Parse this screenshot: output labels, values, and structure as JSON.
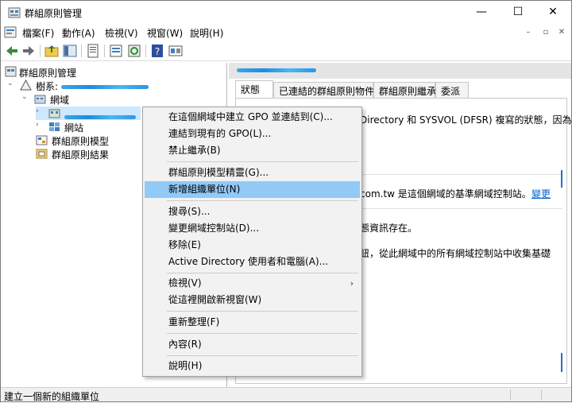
{
  "window": {
    "title": "群組原則管理",
    "controls": {
      "minimize": "—",
      "maximize": "☐",
      "close": "✕"
    }
  },
  "menubar": {
    "items": [
      "檔案(F)",
      "動作(A)",
      "檢視(V)",
      "視窗(W)",
      "說明(H)"
    ],
    "mdi": {
      "minimize": "–",
      "restore": "▫",
      "close": "✕"
    }
  },
  "toolbar": {
    "buttons": [
      "back-icon",
      "forward-icon",
      "folder-up-icon",
      "show-hide-tree-icon",
      "properties-icon",
      "export-list-icon",
      "refresh-icon",
      "help-icon",
      "console-icon"
    ]
  },
  "tree": {
    "root": "群組原則管理",
    "forest_prefix": "樹系: ",
    "domains": "網域",
    "sites": "網站",
    "gpo_modeling": "群組原則模型",
    "gpo_results": "群組原則結果"
  },
  "right": {
    "tabs": [
      "狀態",
      "已連結的群組原則物件",
      "群組原則繼承",
      "委派"
    ],
    "line1": "Directory 和 SYSVOL (DFSR) 複寫的狀態，因為",
    "line2": "com.tw 是這個網域的基準網域控制站。",
    "link": "變更",
    "line3": "態資訊存在。",
    "line4": "鈕，從此網域中的所有網域控制站中收集基礎"
  },
  "context_menu": {
    "items": [
      {
        "label": "在這個網域中建立 GPO 並連結到(C)..."
      },
      {
        "label": "連結到現有的 GPO(L)..."
      },
      {
        "label": "禁止繼承(B)"
      },
      {
        "label": "群組原則模型精靈(G)..."
      },
      {
        "label": "新增組織單位(N)",
        "highlighted": true
      },
      {
        "label": "搜尋(S)..."
      },
      {
        "label": "變更網域控制站(D)..."
      },
      {
        "label": "移除(E)"
      },
      {
        "label": "Active Directory 使用者和電腦(A)..."
      },
      {
        "label": "檢視(V)",
        "submenu": true
      },
      {
        "label": "從這裡開啟新視窗(W)"
      },
      {
        "label": "重新整理(F)"
      },
      {
        "label": "內容(R)"
      },
      {
        "label": "說明(H)"
      }
    ],
    "submenu_arrow": "›"
  },
  "status": {
    "text": "建立一個新的組織單位"
  },
  "colors": {
    "highlight": "#91c9f7",
    "selection": "#cce8ff",
    "link": "#0066cc",
    "redacted": "#1e8de0"
  }
}
